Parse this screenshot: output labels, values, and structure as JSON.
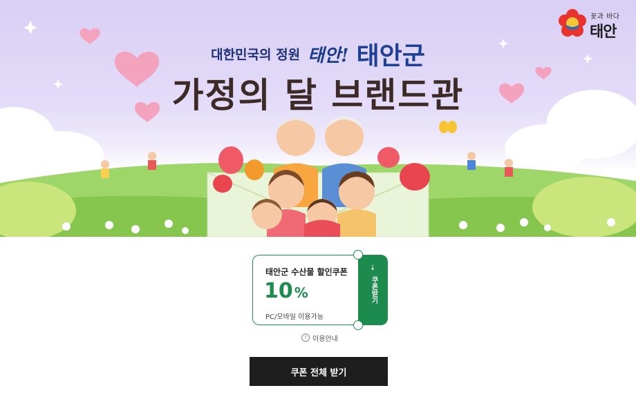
{
  "logo": {
    "tagline": "꽃과 바다",
    "name": "태안"
  },
  "banner": {
    "line1_prefix": "대한민국의 정원",
    "line1_script": "태안!",
    "line1_brand": "태안군",
    "line2": "가정의 달 브랜드관"
  },
  "coupon": {
    "title": "태안군 수산물 할인쿠폰",
    "value": "10",
    "unit": "%",
    "note": "PC/모바일 이용가능",
    "stub_label": "쿠폰받기"
  },
  "usage_info": {
    "icon": "!",
    "label": "이용안내"
  },
  "download_all_button": "쿠폰 전체 받기",
  "colors": {
    "accent_green": "#1d8a4e",
    "button_dark": "#1e1e1e",
    "banner_sky": "#d9cff5",
    "headline_navy": "#1e3f96",
    "headline_brown": "#3b2a26"
  }
}
